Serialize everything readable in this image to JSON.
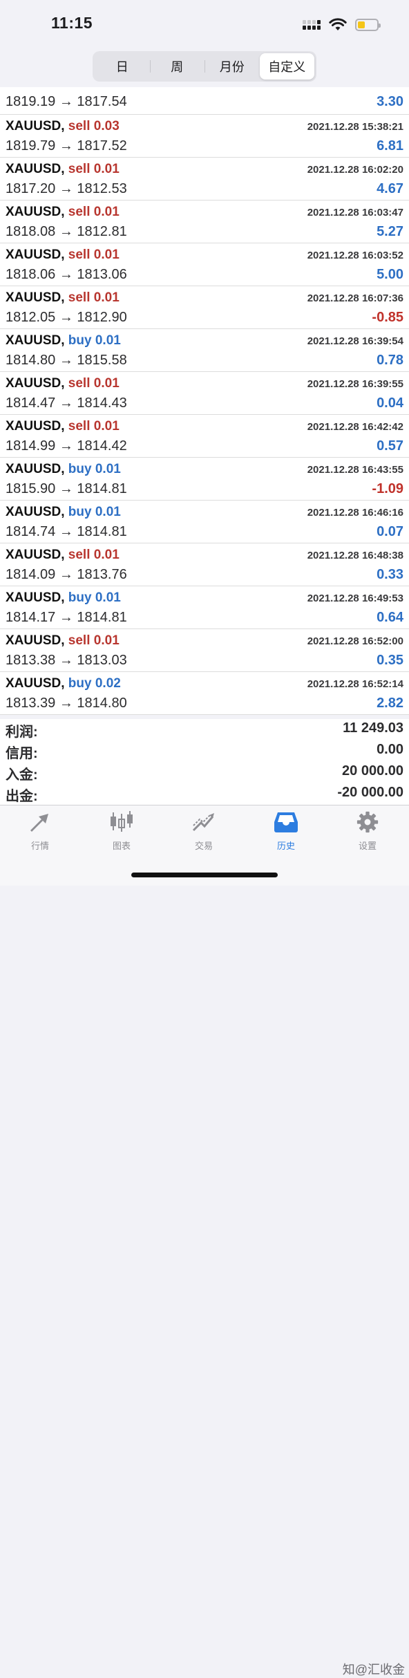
{
  "status": {
    "time": "11:15"
  },
  "segments": [
    {
      "label": "日",
      "active": false
    },
    {
      "label": "周",
      "active": false
    },
    {
      "label": "月份",
      "active": false
    },
    {
      "label": "自定义",
      "active": true
    }
  ],
  "first_row": {
    "prices": "1819.19 → 1817.54",
    "profit": "3.30"
  },
  "trades": [
    {
      "symbol": "XAUUSD,",
      "direction": "sell",
      "lot": "0.03",
      "date": "2021.12.28 15:38:21",
      "prices": "1819.79 → 1817.52",
      "profit": "6.81"
    },
    {
      "symbol": "XAUUSD,",
      "direction": "sell",
      "lot": "0.01",
      "date": "2021.12.28 16:02:20",
      "prices": "1817.20 → 1812.53",
      "profit": "4.67"
    },
    {
      "symbol": "XAUUSD,",
      "direction": "sell",
      "lot": "0.01",
      "date": "2021.12.28 16:03:47",
      "prices": "1818.08 → 1812.81",
      "profit": "5.27"
    },
    {
      "symbol": "XAUUSD,",
      "direction": "sell",
      "lot": "0.01",
      "date": "2021.12.28 16:03:52",
      "prices": "1818.06 → 1813.06",
      "profit": "5.00"
    },
    {
      "symbol": "XAUUSD,",
      "direction": "sell",
      "lot": "0.01",
      "date": "2021.12.28 16:07:36",
      "prices": "1812.05 → 1812.90",
      "profit": "-0.85"
    },
    {
      "symbol": "XAUUSD,",
      "direction": "buy",
      "lot": "0.01",
      "date": "2021.12.28 16:39:54",
      "prices": "1814.80 → 1815.58",
      "profit": "0.78"
    },
    {
      "symbol": "XAUUSD,",
      "direction": "sell",
      "lot": "0.01",
      "date": "2021.12.28 16:39:55",
      "prices": "1814.47 → 1814.43",
      "profit": "0.04"
    },
    {
      "symbol": "XAUUSD,",
      "direction": "sell",
      "lot": "0.01",
      "date": "2021.12.28 16:42:42",
      "prices": "1814.99 → 1814.42",
      "profit": "0.57"
    },
    {
      "symbol": "XAUUSD,",
      "direction": "buy",
      "lot": "0.01",
      "date": "2021.12.28 16:43:55",
      "prices": "1815.90 → 1814.81",
      "profit": "-1.09"
    },
    {
      "symbol": "XAUUSD,",
      "direction": "buy",
      "lot": "0.01",
      "date": "2021.12.28 16:46:16",
      "prices": "1814.74 → 1814.81",
      "profit": "0.07"
    },
    {
      "symbol": "XAUUSD,",
      "direction": "sell",
      "lot": "0.01",
      "date": "2021.12.28 16:48:38",
      "prices": "1814.09 → 1813.76",
      "profit": "0.33"
    },
    {
      "symbol": "XAUUSD,",
      "direction": "buy",
      "lot": "0.01",
      "date": "2021.12.28 16:49:53",
      "prices": "1814.17 → 1814.81",
      "profit": "0.64"
    },
    {
      "symbol": "XAUUSD,",
      "direction": "sell",
      "lot": "0.01",
      "date": "2021.12.28 16:52:00",
      "prices": "1813.38 → 1813.03",
      "profit": "0.35"
    },
    {
      "symbol": "XAUUSD,",
      "direction": "buy",
      "lot": "0.02",
      "date": "2021.12.28 16:52:14",
      "prices": "1813.39 → 1814.80",
      "profit": "2.82"
    }
  ],
  "summary": [
    {
      "label": "利润:",
      "value": "11 249.03"
    },
    {
      "label": "信用:",
      "value": "0.00"
    },
    {
      "label": "入金:",
      "value": "20 000.00"
    },
    {
      "label": "出金:",
      "value": "-20 000.00"
    }
  ],
  "tabs": [
    {
      "label": "行情",
      "icon": "quotes-arrows-icon",
      "active": false
    },
    {
      "label": "图表",
      "icon": "candlestick-chart-icon",
      "active": false
    },
    {
      "label": "交易",
      "icon": "trade-trend-icon",
      "active": false
    },
    {
      "label": "历史",
      "icon": "history-inbox-icon",
      "active": true
    },
    {
      "label": "设置",
      "icon": "gear-icon",
      "active": false
    }
  ],
  "watermark": "知@汇收金",
  "colors": {
    "sell": "#b8362f",
    "buy": "#2d6fc4",
    "positive": "#2d6fc4",
    "negative": "#c0322b",
    "active_tab": "#2d7de0"
  }
}
